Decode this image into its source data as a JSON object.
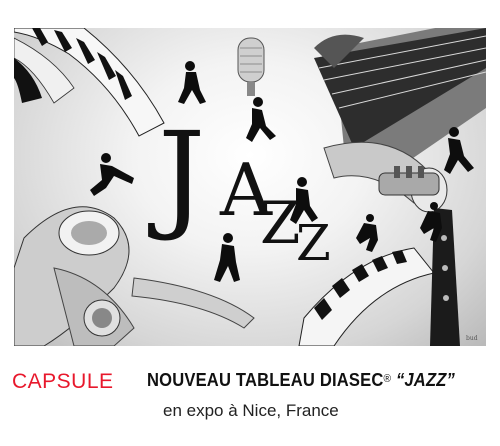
{
  "artwork": {
    "title_letters": [
      "J",
      "A",
      "Z",
      "Z"
    ],
    "signature": "bud"
  },
  "caption": {
    "brand": "CAPSULE",
    "headline_main": "NOUVEAU TABLEAU DIASEC",
    "headline_reg": "®",
    "headline_quote": "“JAZZ”",
    "subline": "en expo à Nice, France"
  },
  "colors": {
    "brand": "#e8182c",
    "text": "#111111"
  }
}
